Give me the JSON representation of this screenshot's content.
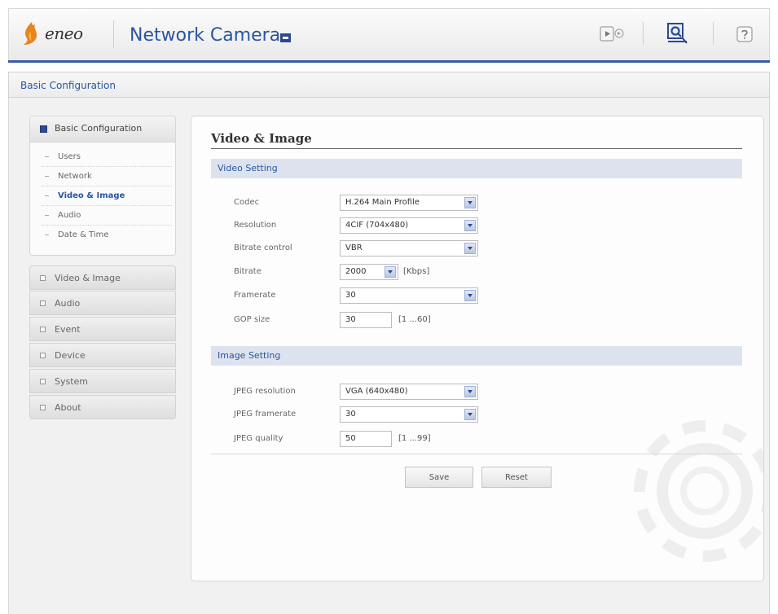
{
  "header": {
    "brand": "eneo",
    "title": "Network Camera"
  },
  "breadcrumb": "Basic Configuration",
  "sidebar": {
    "open_group": {
      "label": "Basic Configuration",
      "items": [
        {
          "label": "Users",
          "active": false
        },
        {
          "label": "Network",
          "active": false
        },
        {
          "label": "Video & Image",
          "active": true
        },
        {
          "label": "Audio",
          "active": false
        },
        {
          "label": "Date & Time",
          "active": false
        }
      ]
    },
    "groups": [
      "Video & Image",
      "Audio",
      "Event",
      "Device",
      "System",
      "About"
    ]
  },
  "main": {
    "title": "Video & Image",
    "video_section": "Video Setting",
    "codec_label": "Codec",
    "codec_value": "H.264 Main Profile",
    "resolution_label": "Resolution",
    "resolution_value": "4CIF (704x480)",
    "bitrate_control_label": "Bitrate control",
    "bitrate_control_value": "VBR",
    "bitrate_label": "Bitrate",
    "bitrate_value": "2000",
    "bitrate_unit": "[Kbps]",
    "framerate_label": "Framerate",
    "framerate_value": "30",
    "gop_label": "GOP size",
    "gop_value": "30",
    "gop_range": "[1 ...60]",
    "image_section": "Image Setting",
    "jpeg_res_label": "JPEG resolution",
    "jpeg_res_value": "VGA (640x480)",
    "jpeg_fps_label": "JPEG framerate",
    "jpeg_fps_value": "30",
    "jpeg_quality_label": "JPEG quality",
    "jpeg_quality_value": "50",
    "jpeg_quality_range": "[1 ...99]",
    "save_label": "Save",
    "reset_label": "Reset"
  },
  "colors": {
    "accent": "#2a55a0",
    "header_line": "#3a5aa8",
    "section_bg": "#dde3ee"
  }
}
